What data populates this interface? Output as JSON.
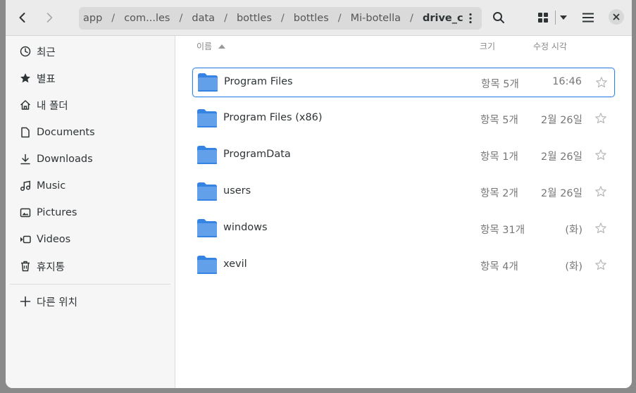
{
  "headerbar": {
    "breadcrumbs": [
      "app",
      "com...les",
      "data",
      "bottles",
      "bottles",
      "Mi-botella",
      "drive_c"
    ],
    "current_folder": "drive_c",
    "back_icon": "chevron-left-icon",
    "forward_icon": "chevron-right-icon",
    "search_icon": "search-icon",
    "view_icon": "grid-view-icon",
    "view_options_icon": "caret-down-icon",
    "menu_icon": "hamburger-menu-icon",
    "close_icon": "close-icon"
  },
  "sidebar": {
    "items": [
      {
        "label": "최근",
        "icon": "clock-icon"
      },
      {
        "label": "별표",
        "icon": "star-icon"
      },
      {
        "label": "내 폴더",
        "icon": "home-icon"
      },
      {
        "label": "Documents",
        "icon": "document-icon"
      },
      {
        "label": "Downloads",
        "icon": "download-icon"
      },
      {
        "label": "Music",
        "icon": "music-icon"
      },
      {
        "label": "Pictures",
        "icon": "picture-icon"
      },
      {
        "label": "Videos",
        "icon": "video-icon"
      },
      {
        "label": "휴지통",
        "icon": "trash-icon"
      }
    ],
    "other_locations": {
      "label": "다른 위치",
      "icon": "plus-icon"
    }
  },
  "columns": {
    "name": "이름",
    "size": "크기",
    "modified": "수정 시각",
    "sort_icon": "sort-ascending-icon"
  },
  "files": [
    {
      "name": "Program Files",
      "size": "항목 5개",
      "modified": "16:46",
      "selected": true
    },
    {
      "name": "Program Files (x86)",
      "size": "항목 5개",
      "modified": "2월 26일",
      "selected": false
    },
    {
      "name": "ProgramData",
      "size": "항목 1개",
      "modified": "2월 26일",
      "selected": false
    },
    {
      "name": "users",
      "size": "항목 2개",
      "modified": "2월 26일",
      "selected": false
    },
    {
      "name": "windows",
      "size": "항목 31개",
      "modified": "(화)",
      "selected": false
    },
    {
      "name": "xevil",
      "size": "항목 4개",
      "modified": "(화)",
      "selected": false
    }
  ],
  "colors": {
    "accent": "#3584e4",
    "folder_body": "#62a0ea",
    "folder_tab": "#3584e4"
  }
}
